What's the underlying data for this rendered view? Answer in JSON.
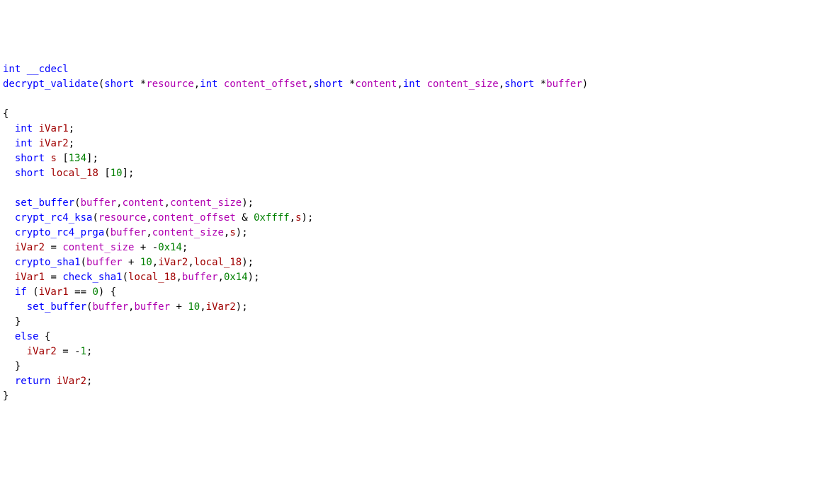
{
  "code": {
    "line1": {
      "kw_int": "int",
      "kw_cdecl": "__cdecl"
    },
    "line2": {
      "fname": "decrypt_validate",
      "lp": "(",
      "p1t": "short",
      "p1s": " *",
      "p1n": "resource",
      "c1": ",",
      "p2t": "int",
      "p2s": " ",
      "p2n": "content_offset",
      "c2": ",",
      "p3t": "short",
      "p3s": " *",
      "p3n": "content",
      "c3": ",",
      "p4t": "int",
      "p4s": " ",
      "p4n": "content_size",
      "c4": ",",
      "p5t": "short",
      "p5s": " *",
      "p5n": "buffer",
      "rp": ")"
    },
    "line4": "{",
    "line5": {
      "pad": "  ",
      "t": "int",
      "sp": " ",
      "v": "iVar1",
      "e": ";"
    },
    "line6": {
      "pad": "  ",
      "t": "int",
      "sp": " ",
      "v": "iVar2",
      "e": ";"
    },
    "line7": {
      "pad": "  ",
      "t": "short",
      "sp": " ",
      "v": "s",
      "br1": " [",
      "sz": "134",
      "br2": "];"
    },
    "line8": {
      "pad": "  ",
      "t": "short",
      "sp": " ",
      "v": "local_18",
      "br1": " [",
      "sz": "10",
      "br2": "];"
    },
    "line10": {
      "pad": "  ",
      "fn": "set_buffer",
      "lp": "(",
      "a1": "buffer",
      "c1": ",",
      "a2": "content",
      "c2": ",",
      "a3": "content_size",
      "rp": ");"
    },
    "line11": {
      "pad": "  ",
      "fn": "crypt_rc4_ksa",
      "lp": "(",
      "a1": "resource",
      "c1": ",",
      "a2": "content_offset",
      "op": " & ",
      "lit": "0xffff",
      "c2": ",",
      "a3": "s",
      "rp": ");"
    },
    "line12": {
      "pad": "  ",
      "fn": "crypto_rc4_prga",
      "lp": "(",
      "a1": "buffer",
      "c1": ",",
      "a2": "content_size",
      "c2": ",",
      "a3": "s",
      "rp": ");"
    },
    "line13": {
      "pad": "  ",
      "v": "iVar2",
      "op1": " = ",
      "a1": "content_size",
      "op2": " + ",
      "neg": "-",
      "lit": "0x14",
      "e": ";"
    },
    "line14": {
      "pad": "  ",
      "fn": "crypto_sha1",
      "lp": "(",
      "a1": "buffer",
      "op": " + ",
      "lit": "10",
      "c1": ",",
      "a2": "iVar2",
      "c2": ",",
      "a3": "local_18",
      "rp": ");"
    },
    "line15": {
      "pad": "  ",
      "v": "iVar1",
      "op": " = ",
      "fn": "check_sha1",
      "lp": "(",
      "a1": "local_18",
      "c1": ",",
      "a2": "buffer",
      "c2": ",",
      "lit": "0x14",
      "rp": ");"
    },
    "line16": {
      "pad": "  ",
      "kw": "if",
      "lp": " (",
      "v": "iVar1",
      "op": " == ",
      "lit": "0",
      "rp": ") {"
    },
    "line17": {
      "pad": "    ",
      "fn": "set_buffer",
      "lp": "(",
      "a1": "buffer",
      "c1": ",",
      "a2": "buffer",
      "op": " + ",
      "lit": "10",
      "c2": ",",
      "a3": "iVar2",
      "rp": ");"
    },
    "line18": "  }",
    "line19": {
      "pad": "  ",
      "kw": "else",
      "brace": " {"
    },
    "line20": {
      "pad": "    ",
      "v": "iVar2",
      "op": " = ",
      "neg": "-",
      "lit": "1",
      "e": ";"
    },
    "line21": "  }",
    "line22": {
      "pad": "  ",
      "kw": "return",
      "sp": " ",
      "v": "iVar2",
      "e": ";"
    },
    "line23": "}"
  }
}
